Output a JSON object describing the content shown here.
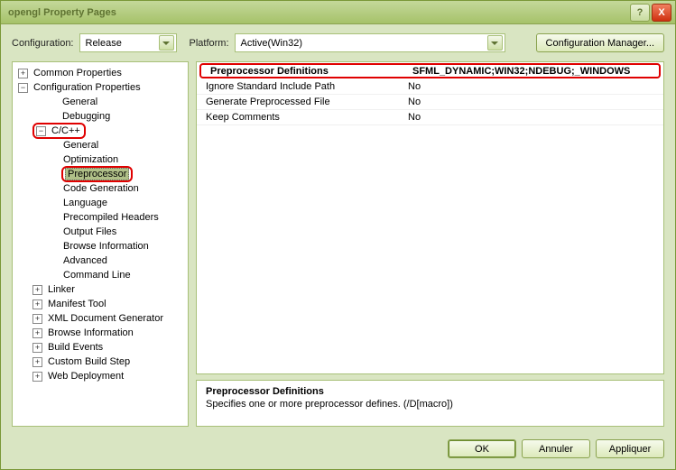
{
  "window": {
    "title": "opengl Property Pages"
  },
  "titlebar_buttons": {
    "help": "?",
    "close": "X"
  },
  "topbar": {
    "config_label": "Configuration:",
    "config_value": "Release",
    "platform_label": "Platform:",
    "platform_value": "Active(Win32)",
    "config_manager": "Configuration Manager..."
  },
  "tree": {
    "common_properties": "Common Properties",
    "configuration_properties": "Configuration Properties",
    "general": "General",
    "debugging": "Debugging",
    "ccpp": "C/C++",
    "ccpp_general": "General",
    "ccpp_optimization": "Optimization",
    "ccpp_preprocessor": "Preprocessor",
    "ccpp_codegen": "Code Generation",
    "ccpp_language": "Language",
    "ccpp_pch": "Precompiled Headers",
    "ccpp_output": "Output Files",
    "ccpp_browse": "Browse Information",
    "ccpp_advanced": "Advanced",
    "ccpp_cmdline": "Command Line",
    "linker": "Linker",
    "manifest": "Manifest Tool",
    "xmldoc": "XML Document Generator",
    "browseinfo": "Browse Information",
    "buildevents": "Build Events",
    "custombuild": "Custom Build Step",
    "webdeploy": "Web Deployment"
  },
  "grid": {
    "rows": [
      {
        "name": "Preprocessor Definitions",
        "value": "SFML_DYNAMIC;WIN32;NDEBUG;_WINDOWS",
        "bold": true,
        "highlight": true
      },
      {
        "name": "Ignore Standard Include Path",
        "value": "No"
      },
      {
        "name": "Generate Preprocessed File",
        "value": "No"
      },
      {
        "name": "Keep Comments",
        "value": "No"
      }
    ]
  },
  "desc": {
    "title": "Preprocessor Definitions",
    "text": "Specifies one or more preprocessor defines.     (/D[macro])"
  },
  "footer": {
    "ok": "OK",
    "cancel": "Annuler",
    "apply": "Appliquer"
  }
}
